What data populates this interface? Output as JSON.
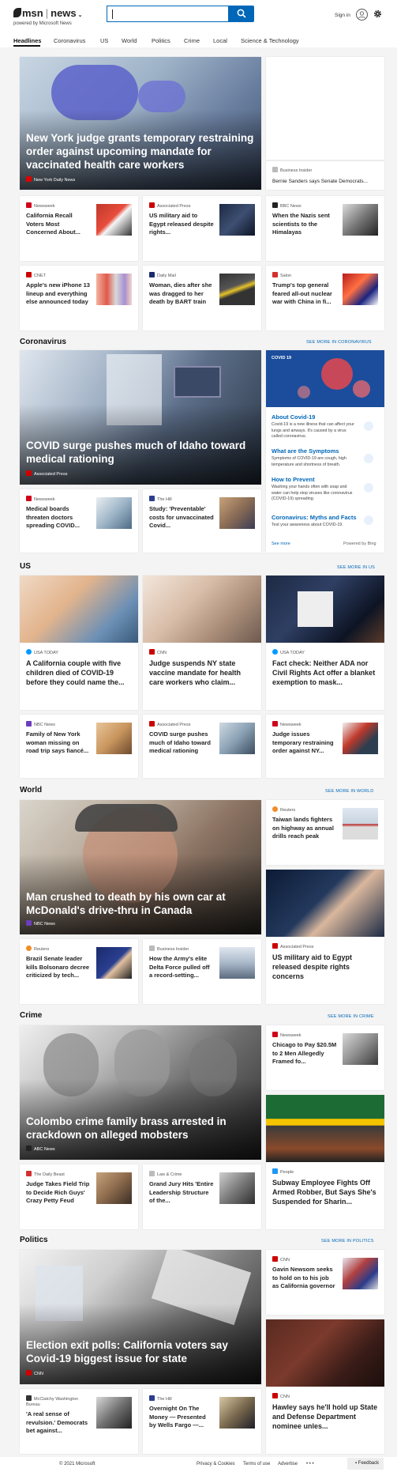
{
  "header": {
    "logo": "msn",
    "section": "news",
    "powered_by": "powered by Microsoft News",
    "sign_in": "Sign in"
  },
  "nav": [
    "Headlines",
    "Coronavirus",
    "US",
    "World",
    "Politics",
    "Crime",
    "Local",
    "Science & Technology"
  ],
  "headlines": {
    "hero": {
      "title": "New York judge grants temporary restraining order against upcoming mandate for vaccinated health care workers",
      "source": "New York Daily News"
    },
    "side": {
      "source": "Business Insider",
      "title": "Bernie Sanders says Senate Democrats..."
    },
    "row1": [
      {
        "source": "Newsweek",
        "title": "California Recall Voters Most Concerned About..."
      },
      {
        "source": "Associated Press",
        "title": "US military aid to Egypt released despite rights..."
      },
      {
        "source": "BBC News",
        "title": "When the Nazis sent scientists to the Himalayas"
      }
    ],
    "row2": [
      {
        "source": "CNET",
        "title": "Apple's new iPhone 13 lineup and everything else announced today"
      },
      {
        "source": "Daily Mail",
        "title": "Woman, dies after she was dragged to her death by BART train"
      },
      {
        "source": "Salon",
        "title": "Trump's top general feared all-out nuclear war with China in fi..."
      }
    ]
  },
  "coronavirus": {
    "heading": "Coronavirus",
    "see_more": "SEE MORE IN CORONAVIRUS",
    "hero": {
      "title": "COVID surge pushes much of Idaho toward medical rationing",
      "source": "Associated Press"
    },
    "panel": {
      "tag": "COVID 19",
      "items": [
        {
          "title": "About Covid-19",
          "desc": "Covid-19 is a new illness that can affect your lungs and airways. It's caused by a virus called coronavirus."
        },
        {
          "title": "What are the Symptoms",
          "desc": "Symptoms of COVID-19 are cough, high temperature and shortness of breath."
        },
        {
          "title": "How to Prevent",
          "desc": "Washing your hands often with soap and water can help stop viruses like coronavirus (COVID-19) spreading."
        },
        {
          "title": "Coronavirus: Myths and Facts",
          "desc": "Test your awareness about COVID-19."
        }
      ],
      "see_more": "See more",
      "powered": "Powered by Bing"
    },
    "row": [
      {
        "source": "Newsweek",
        "title": "Medical boards threaten doctors spreading COVID..."
      },
      {
        "source": "The Hill",
        "title": "Study: 'Preventable' costs for unvaccinated Covid..."
      }
    ]
  },
  "us": {
    "heading": "US",
    "see_more": "SEE MORE IN US",
    "cards": [
      {
        "source": "USA TODAY",
        "title": "A California couple with five children died of COVID-19 before they could name the..."
      },
      {
        "source": "CNN",
        "title": "Judge suspends NY state vaccine mandate for health care workers who claim..."
      },
      {
        "source": "USA TODAY",
        "title": "Fact check: Neither ADA nor Civil Rights Act offer a blanket exemption to mask..."
      }
    ],
    "row": [
      {
        "source": "NBC News",
        "title": "Family of New York woman missing on road trip says fiancé..."
      },
      {
        "source": "Associated Press",
        "title": "COVID surge pushes much of Idaho toward medical rationing"
      },
      {
        "source": "Newsweek",
        "title": "Judge issues temporary restraining order against NY..."
      }
    ]
  },
  "world": {
    "heading": "World",
    "see_more": "SEE MORE IN WORLD",
    "hero": {
      "title": "Man crushed to death by his own car at McDonald's drive-thru in Canada",
      "source": "NBC News"
    },
    "side_small": {
      "source": "Reuters",
      "title": "Taiwan lands fighters on highway as annual drills reach peak"
    },
    "side_med": {
      "source": "Associated Press",
      "title": "US military aid to Egypt released despite rights concerns"
    },
    "row": [
      {
        "source": "Reuters",
        "title": "Brazil Senate leader kills Bolsonaro decree criticized by tech..."
      },
      {
        "source": "Business Insider",
        "title": "How the Army's elite Delta Force pulled off a record-setting..."
      }
    ]
  },
  "crime": {
    "heading": "Crime",
    "see_more": "SEE MORE IN CRIME",
    "hero": {
      "title": "Colombo crime family brass arrested in crackdown on alleged mobsters",
      "source": "ABC News"
    },
    "side_small": {
      "source": "Newsweek",
      "title": "Chicago to Pay $20.5M to 2 Men Allegedly Framed fo..."
    },
    "side_med": {
      "source": "People",
      "title": "Subway Employee Fights Off Armed Robber, But Says She's Suspended for Sharin..."
    },
    "row": [
      {
        "source": "The Daily Beast",
        "title": "Judge Takes Field Trip to Decide Rich Guys' Crazy Petty Feud"
      },
      {
        "source": "Law & Crime",
        "title": "Grand Jury Hits 'Entire Leadership Structure of the..."
      }
    ]
  },
  "politics": {
    "heading": "Politics",
    "see_more": "SEE MORE IN POLITICS",
    "hero": {
      "title": "Election exit polls: California voters say Covid-19 biggest issue for state",
      "source": "CNN"
    },
    "side_small": {
      "source": "CNN",
      "title": "Gavin Newsom seeks to hold on to his job as California governor"
    },
    "side_med": {
      "source": "CNN",
      "title": "Hawley says he'll hold up State and Defense Department nominee unles..."
    },
    "row": [
      {
        "source": "McClatchy Washington Bureau",
        "title": "'A real sense of revulsion.' Democrats bet against..."
      },
      {
        "source": "The Hill",
        "title": "Overnight On The Money — Presented by Wells Fargo —..."
      }
    ]
  },
  "footer": {
    "copyright": "© 2021 Microsoft",
    "links": [
      "Privacy & Cookies",
      "Terms of use",
      "Advertise"
    ],
    "more": "• • •",
    "feedback": "Feedback"
  },
  "colors": {
    "accent": "#0067b8",
    "cnn": "#cc0000",
    "newsweek": "#d0021b"
  }
}
